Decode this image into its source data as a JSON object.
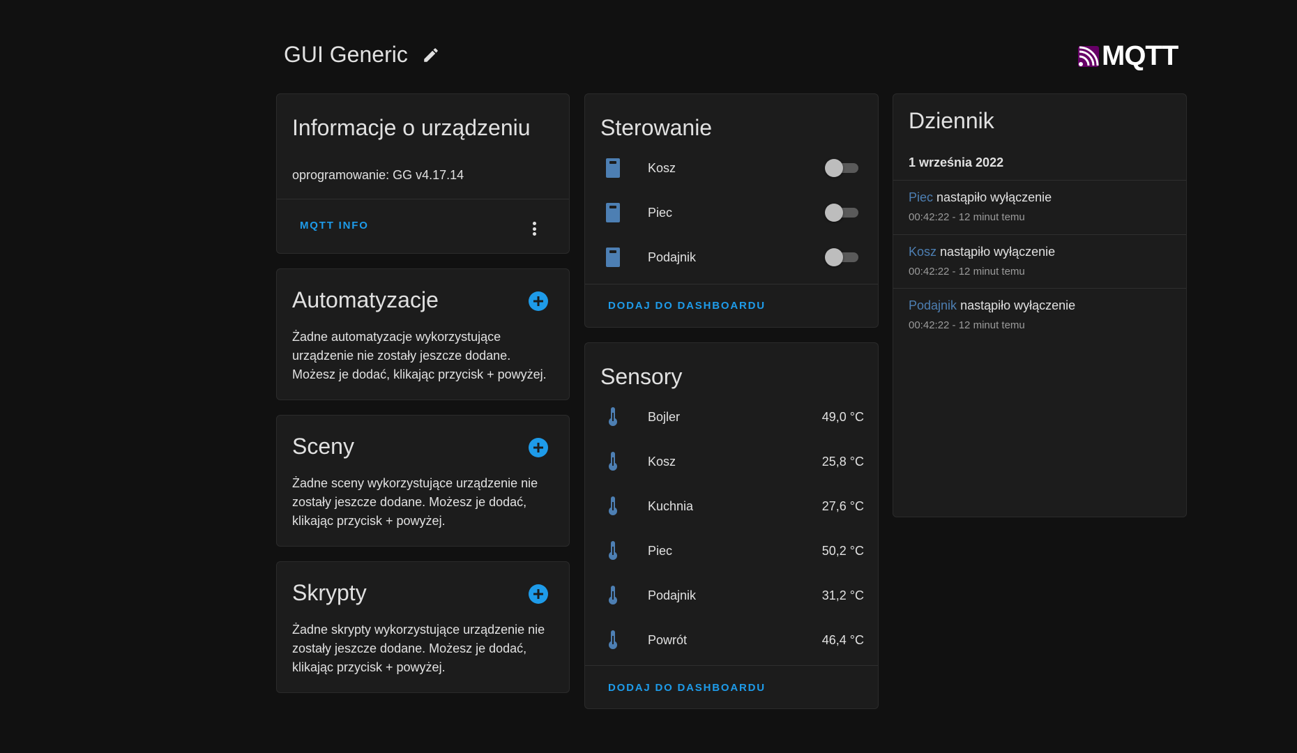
{
  "header": {
    "title": "GUI Generic",
    "edit_icon": "pencil-icon",
    "logo_text": "MQTT",
    "logo_icon": "mqtt-logo"
  },
  "colors": {
    "accent": "#1e9be9",
    "entity_icon": "#4d7fb3",
    "card_bg": "#1c1c1c",
    "page_bg": "#111111"
  },
  "device_info": {
    "title": "Informacje o urządzeniu",
    "firmware": "oprogramowanie: GG v4.17.14",
    "action": "MQTT INFO",
    "menu_icon": "dots-vertical-icon"
  },
  "automations": {
    "title": "Automatyzacje",
    "text": "Żadne automatyzacje wykorzystujące urządzenie nie zostały jeszcze dodane. Możesz je dodać, klikając przycisk + powyżej.",
    "add_icon": "plus-circle-icon"
  },
  "scenes": {
    "title": "Sceny",
    "text": "Żadne sceny wykorzystujące urządzenie nie zostały jeszcze dodane. Możesz je dodać, klikając przycisk + powyżej.",
    "add_icon": "plus-circle-icon"
  },
  "scripts": {
    "title": "Skrypty",
    "text": "Żadne skrypty wykorzystujące urządzenie nie zostały jeszcze dodane. Możesz je dodać, klikając przycisk + powyżej.",
    "add_icon": "plus-circle-icon"
  },
  "controls": {
    "title": "Sterowanie",
    "items": [
      {
        "label": "Kosz",
        "icon": "light-switch-icon",
        "state": "off"
      },
      {
        "label": "Piec",
        "icon": "light-switch-icon",
        "state": "off"
      },
      {
        "label": "Podajnik",
        "icon": "light-switch-icon",
        "state": "off"
      }
    ],
    "action": "DODAJ DO DASHBOARDU"
  },
  "sensors": {
    "title": "Sensory",
    "items": [
      {
        "label": "Bojler",
        "value": "49,0 °C",
        "icon": "thermometer-icon"
      },
      {
        "label": "Kosz",
        "value": "25,8 °C",
        "icon": "thermometer-icon"
      },
      {
        "label": "Kuchnia",
        "value": "27,6 °C",
        "icon": "thermometer-icon"
      },
      {
        "label": "Piec",
        "value": "50,2 °C",
        "icon": "thermometer-icon"
      },
      {
        "label": "Podajnik",
        "value": "31,2 °C",
        "icon": "thermometer-icon"
      },
      {
        "label": "Powrót",
        "value": "46,4 °C",
        "icon": "thermometer-icon"
      }
    ],
    "action": "DODAJ DO DASHBOARDU"
  },
  "logbook": {
    "title": "Dziennik",
    "date": "1 września 2022",
    "entries": [
      {
        "entity": "Piec",
        "message": "nastąpiło wyłączenie",
        "time": "00:42:22 - 12 minut temu"
      },
      {
        "entity": "Kosz",
        "message": "nastąpiło wyłączenie",
        "time": "00:42:22 - 12 minut temu"
      },
      {
        "entity": "Podajnik",
        "message": "nastąpiło wyłączenie",
        "time": "00:42:22 - 12 minut temu"
      }
    ]
  }
}
